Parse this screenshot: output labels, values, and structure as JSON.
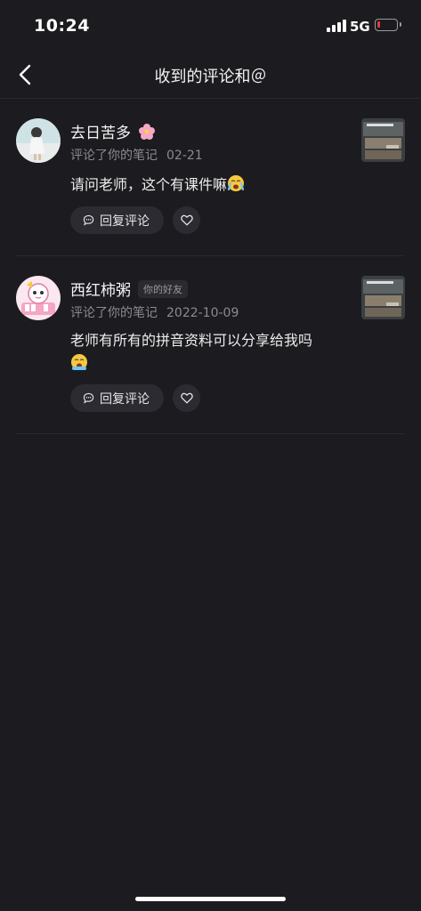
{
  "status_bar": {
    "time": "10:24",
    "network": "5G",
    "icons": [
      "signal-icon",
      "battery-low-icon"
    ]
  },
  "nav": {
    "title": "收到的评论和＠",
    "back_icon": "chevron-left-icon"
  },
  "comments": [
    {
      "username": "去日苦多",
      "action": "评论了你的笔记",
      "date": "02-21",
      "text": "请问老师，这个有课件嘛",
      "reply_label": "回复评论",
      "icons": [
        "flower-emoji-icon",
        "crying-emoji-icon",
        "chat-bubble-icon",
        "heart-icon"
      ]
    },
    {
      "username": "西红柿粥",
      "badge": "你的好友",
      "action": "评论了你的笔记",
      "date": "2022-10-09",
      "text": "老师有所有的拼音资料可以分享给我吗",
      "reply_label": "回复评论",
      "icons": [
        "crying-emoji-icon",
        "chat-bubble-icon",
        "heart-icon"
      ]
    }
  ],
  "colors": {
    "background": "#1c1b1f",
    "button_bg": "#2c2b31",
    "meta_text": "#8b8b8f",
    "battery_low": "#e23a3a"
  }
}
